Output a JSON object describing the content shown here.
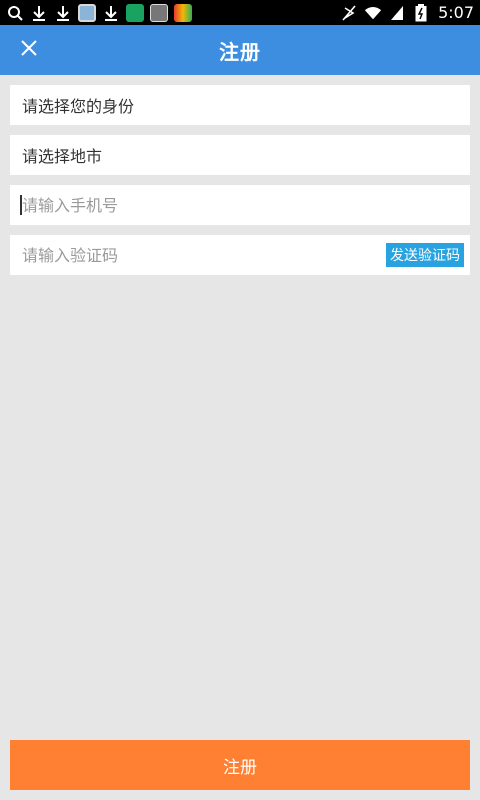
{
  "status_bar": {
    "time": "5:07",
    "left_icons": [
      "search-icon",
      "download-icon",
      "download-icon",
      "app-icon",
      "download-icon",
      "app-icon",
      "app-icon",
      "app-icon"
    ],
    "right_icons": [
      "mute-icon",
      "wifi-icon",
      "signal-icon",
      "battery-icon"
    ]
  },
  "appbar": {
    "title": "注册",
    "close_icon": "close-icon"
  },
  "form": {
    "identity_label": "请选择您的身份",
    "city_label": "请选择地市",
    "phone_placeholder": "请输入手机号",
    "code_placeholder": "请输入验证码",
    "send_code_label": "发送验证码"
  },
  "submit": {
    "label": "注册"
  },
  "colors": {
    "appbar": "#3d8ee0",
    "background": "#e6e6e6",
    "send_button": "#29a3e0",
    "submit_button": "#ff7f33"
  }
}
